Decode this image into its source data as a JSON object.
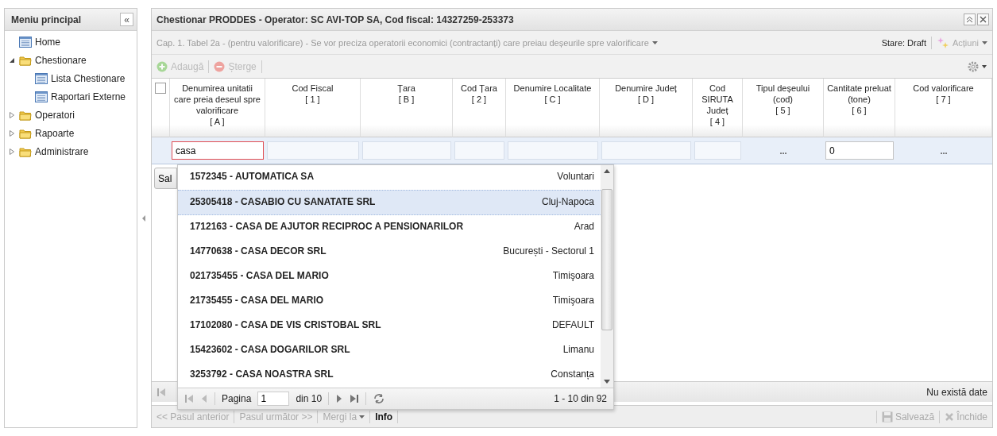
{
  "sidebar": {
    "title": "Meniu principal",
    "collapse": "«",
    "items": [
      {
        "label": "Home",
        "kind": "page"
      },
      {
        "label": "Chestionare",
        "kind": "folder",
        "expanded": true,
        "children": [
          {
            "label": "Lista Chestionare",
            "kind": "page"
          },
          {
            "label": "Raportari Externe",
            "kind": "page"
          }
        ]
      },
      {
        "label": "Operatori",
        "kind": "folder",
        "expanded": false
      },
      {
        "label": "Rapoarte",
        "kind": "folder",
        "expanded": false
      },
      {
        "label": "Administrare",
        "kind": "folder",
        "expanded": false
      }
    ]
  },
  "panel": {
    "title": "Chestionar PRODDES - Operator: SC AVI-TOP SA, Cod fiscal: 14327259-253373",
    "section": "Cap. 1. Tabel 2a - (pentru valorificare) - Se vor preciza operatorii economici (contractanți) care preiau deșeurile spre valorificare",
    "status": "Stare: Draft",
    "actions": "Acțiuni",
    "toolbar": [
      {
        "label": "Adaugă",
        "kind": "add",
        "disabled": true
      },
      {
        "label": "Șterge",
        "kind": "delete",
        "disabled": true
      }
    ],
    "columns": [
      {
        "label": "Denumirea unitatii care preia deseul spre valorificare",
        "code": "[ A ]"
      },
      {
        "label": "Cod Fiscal",
        "code": "[ 1 ]"
      },
      {
        "label": "Țara",
        "code": "[ B ]"
      },
      {
        "label": "Cod Țara",
        "code": "[ 2 ]"
      },
      {
        "label": "Denumire Localitate",
        "code": "[ C ]"
      },
      {
        "label": "Denumire Județ",
        "code": "[ D ]"
      },
      {
        "label": "Cod SIRUTA Județ",
        "code": "[ 4 ]"
      },
      {
        "label": "Tipul deșeului (cod)",
        "code": "[ 5 ]"
      },
      {
        "label": "Cantitate preluat (tone)",
        "code": "[ 6 ]"
      },
      {
        "label": "Cod valorificare",
        "code": "[ 7 ]"
      }
    ],
    "select_all": {
      "checked": false
    },
    "edit_row": [
      {
        "kind": "input",
        "value": "casa",
        "focused": true
      },
      {
        "kind": "input",
        "focused": false
      },
      {
        "kind": "input",
        "focused": false
      },
      {
        "kind": "input",
        "focused": false
      },
      {
        "kind": "input",
        "focused": false
      },
      {
        "kind": "input",
        "focused": false
      },
      {
        "kind": "input",
        "focused": false
      },
      {
        "kind": "picker",
        "value": "...",
        "focused": false
      },
      {
        "kind": "input",
        "value": "0",
        "focused": false
      },
      {
        "kind": "picker",
        "value": "...",
        "focused": false
      }
    ],
    "save_button_partial": "Sal",
    "empty_text": "Nu există date",
    "nav": [
      {
        "label": "<< Pasul anterior",
        "disabled": true,
        "kind": "link"
      },
      {
        "label": "Pasul următor >>",
        "disabled": true,
        "kind": "link"
      },
      {
        "label": "Mergi la",
        "disabled": true,
        "kind": "menu"
      },
      {
        "label": "Info",
        "disabled": false,
        "kind": "link"
      }
    ],
    "footer_buttons": [
      {
        "label": "Salvează",
        "kind": "save",
        "disabled": true
      },
      {
        "label": "Închide",
        "kind": "close",
        "disabled": true
      }
    ]
  },
  "dropdown": {
    "items": [
      {
        "name": "1572345 - AUTOMATICA SA",
        "locality": "Voluntari",
        "selected": false
      },
      {
        "name": "25305418 - CASABIO CU SANATATE SRL",
        "locality": "Cluj-Napoca",
        "selected": true
      },
      {
        "name": "1712163 - CASA DE AJUTOR RECIPROC A PENSIONARILOR",
        "locality": "Arad",
        "selected": false
      },
      {
        "name": "14770638 - CASA DECOR SRL",
        "locality": "București - Sectorul 1",
        "selected": false
      },
      {
        "name": "021735455 - CASA DEL MARIO",
        "locality": "Timişoara",
        "selected": false
      },
      {
        "name": "21735455 - CASA DEL MARIO",
        "locality": "Timişoara",
        "selected": false
      },
      {
        "name": "17102080 - CASA DE VIS CRISTOBAL SRL",
        "locality": "DEFAULT",
        "selected": false
      },
      {
        "name": "15423602 - CASA DOGARILOR SRL",
        "locality": "Limanu",
        "selected": false
      },
      {
        "name": "3253792 - CASA NOASTRA SRL",
        "locality": "Constanța",
        "selected": false
      }
    ],
    "pager": {
      "page_label": "Pagina",
      "page": "1",
      "of": "din 10",
      "summary": "1 - 10 din 92"
    }
  }
}
